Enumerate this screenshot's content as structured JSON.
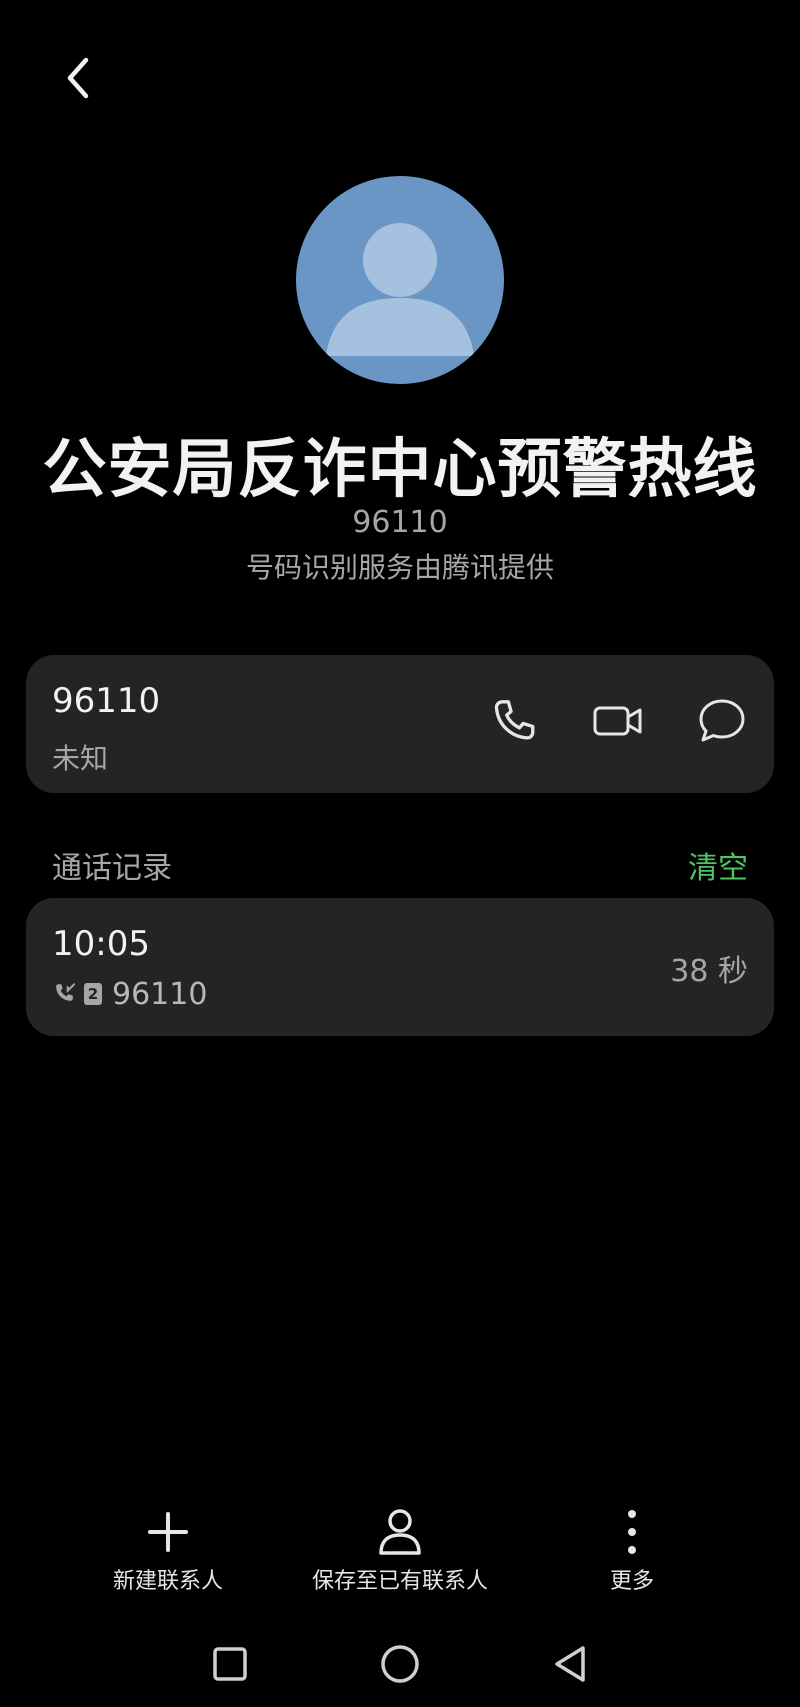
{
  "header": {
    "back_icon": "chevron-left-icon"
  },
  "contact": {
    "name": "公安局反诈中心预警热线",
    "number": "96110",
    "provider_note": "号码识别服务由腾讯提供",
    "avatar_color": "#6a96c6"
  },
  "number_card": {
    "number": "96110",
    "label": "未知",
    "actions": [
      {
        "icon": "phone-icon"
      },
      {
        "icon": "video-call-icon"
      },
      {
        "icon": "message-icon"
      }
    ]
  },
  "call_log": {
    "title": "通话记录",
    "clear_label": "清空",
    "accent_color": "#4cc463",
    "records": [
      {
        "time": "10:05",
        "sim": "2",
        "number": "96110",
        "duration": "38 秒",
        "type_icon": "incoming-call-icon"
      }
    ]
  },
  "bottom_bar": {
    "new_contact": "新建联系人",
    "save_existing": "保存至已有联系人",
    "more": "更多"
  },
  "system_nav": {
    "recent_icon": "square-icon",
    "home_icon": "circle-icon",
    "back_icon": "triangle-back-icon"
  }
}
